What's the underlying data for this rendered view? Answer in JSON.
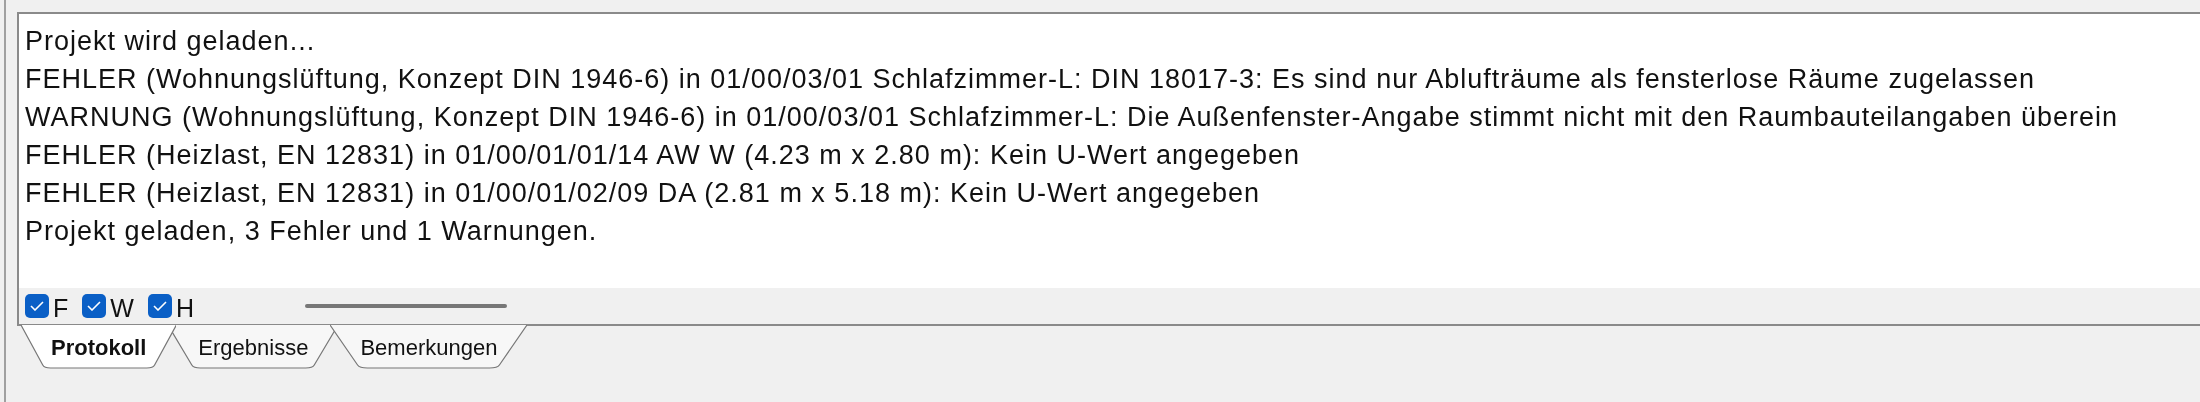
{
  "log": {
    "lines": [
      "Projekt wird geladen...",
      "FEHLER (Wohnungslüftung, Konzept DIN 1946-6) in 01/00/03/01 Schlafzimmer-L: DIN 18017-3: Es sind nur Ablufträume als fensterlose Räume zugelassen",
      "WARNUNG (Wohnungslüftung, Konzept DIN 1946-6) in 01/00/03/01 Schlafzimmer-L: Die Außenfenster-Angabe stimmt nicht mit den Raumbauteilangaben überein",
      "FEHLER (Heizlast, EN 12831) in 01/00/01/01/14 AW W (4.23 m x 2.80 m): Kein U-Wert angegeben",
      "FEHLER (Heizlast, EN 12831) in 01/00/01/02/09 DA (2.81 m x 5.18 m): Kein U-Wert angegeben",
      "Projekt geladen, 3 Fehler und 1 Warnungen."
    ]
  },
  "filters": [
    {
      "label": "F",
      "checked": true
    },
    {
      "label": "W",
      "checked": true
    },
    {
      "label": "H",
      "checked": true
    }
  ],
  "tabs": [
    {
      "label": "Protokoll",
      "selected": true
    },
    {
      "label": "Ergebnisse",
      "selected": false
    },
    {
      "label": "Bemerkungen",
      "selected": false
    }
  ]
}
